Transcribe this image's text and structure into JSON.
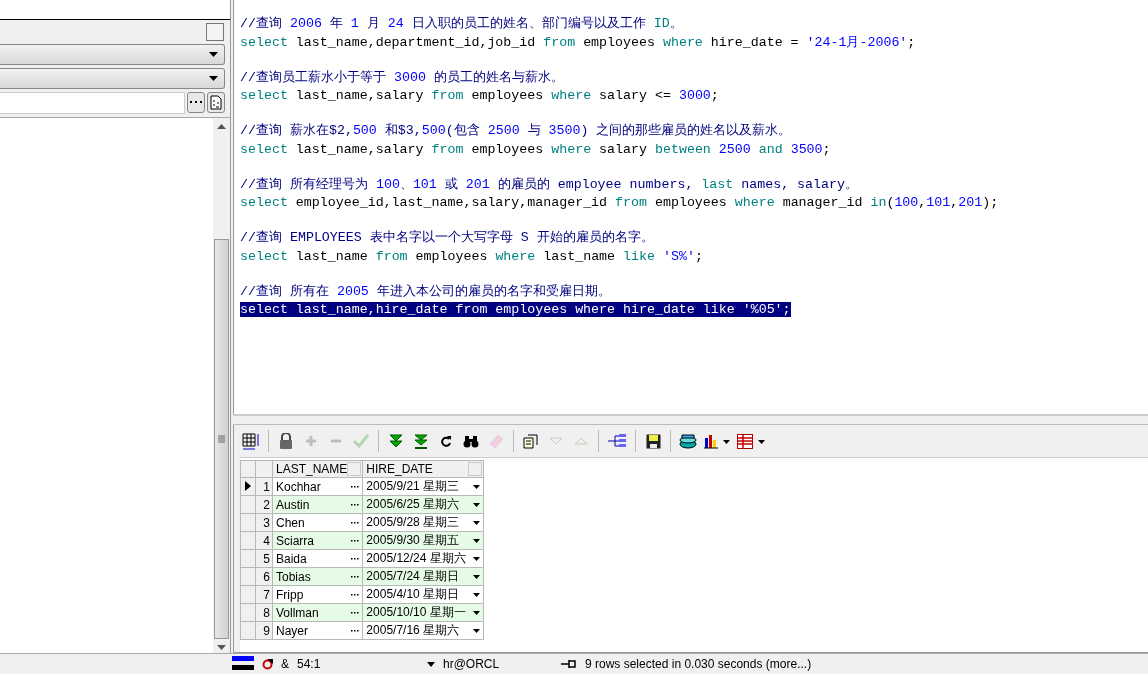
{
  "left_panel": {
    "checkbox": {
      "checked": false
    }
  },
  "editor": {
    "blocks": [
      {
        "lines": [
          {
            "selected": false,
            "tokens": [
              {
                "t": "//查询 ",
                "kind": "comment"
              },
              {
                "t": "2006",
                "kind": "number"
              },
              {
                "t": " 年 ",
                "kind": "comment"
              },
              {
                "t": "1",
                "kind": "number"
              },
              {
                "t": " 月 ",
                "kind": "comment"
              },
              {
                "t": "24",
                "kind": "number"
              },
              {
                "t": " 日入职的员工的姓名、部门编号以及工作 ",
                "kind": "comment"
              },
              {
                "t": "ID",
                "kind": "keyword"
              },
              {
                "t": "。",
                "kind": "comment"
              }
            ]
          },
          {
            "selected": false,
            "tokens": [
              {
                "t": "select",
                "kind": "keyword"
              },
              {
                "t": " last_name,department_id,job_id ",
                "kind": "plain"
              },
              {
                "t": "from",
                "kind": "keyword"
              },
              {
                "t": " employees ",
                "kind": "plain"
              },
              {
                "t": "where",
                "kind": "keyword"
              },
              {
                "t": " hire_date = ",
                "kind": "plain"
              },
              {
                "t": "'24-1月-2006'",
                "kind": "string"
              },
              {
                "t": ";",
                "kind": "plain"
              }
            ]
          }
        ]
      },
      {
        "lines": [
          {
            "selected": false,
            "tokens": [
              {
                "t": "//查询员工薪水小于等于 ",
                "kind": "comment"
              },
              {
                "t": "3000",
                "kind": "number"
              },
              {
                "t": " 的员工的姓名与薪水。",
                "kind": "comment"
              }
            ]
          },
          {
            "selected": false,
            "tokens": [
              {
                "t": "select",
                "kind": "keyword"
              },
              {
                "t": " last_name,salary ",
                "kind": "plain"
              },
              {
                "t": "from",
                "kind": "keyword"
              },
              {
                "t": " employees ",
                "kind": "plain"
              },
              {
                "t": "where",
                "kind": "keyword"
              },
              {
                "t": " salary <= ",
                "kind": "plain"
              },
              {
                "t": "3000",
                "kind": "number"
              },
              {
                "t": ";",
                "kind": "plain"
              }
            ]
          }
        ]
      },
      {
        "lines": [
          {
            "selected": false,
            "tokens": [
              {
                "t": "//查询 薪水在$2,",
                "kind": "comment"
              },
              {
                "t": "500",
                "kind": "number"
              },
              {
                "t": " 和$3,",
                "kind": "comment"
              },
              {
                "t": "500",
                "kind": "number"
              },
              {
                "t": "(包含 ",
                "kind": "comment"
              },
              {
                "t": "2500",
                "kind": "number"
              },
              {
                "t": " 与 ",
                "kind": "comment"
              },
              {
                "t": "3500",
                "kind": "number"
              },
              {
                "t": ") 之间的那些雇员的姓名以及薪水。",
                "kind": "comment"
              }
            ]
          },
          {
            "selected": false,
            "tokens": [
              {
                "t": "select",
                "kind": "keyword"
              },
              {
                "t": " last_name,salary ",
                "kind": "plain"
              },
              {
                "t": "from",
                "kind": "keyword"
              },
              {
                "t": " employees ",
                "kind": "plain"
              },
              {
                "t": "where",
                "kind": "keyword"
              },
              {
                "t": " salary ",
                "kind": "plain"
              },
              {
                "t": "between ",
                "kind": "keyword"
              },
              {
                "t": "2500 ",
                "kind": "number"
              },
              {
                "t": "and ",
                "kind": "keyword"
              },
              {
                "t": "3500",
                "kind": "number"
              },
              {
                "t": ";",
                "kind": "plain"
              }
            ]
          }
        ]
      },
      {
        "lines": [
          {
            "selected": false,
            "tokens": [
              {
                "t": "//查询 所有经理号为 ",
                "kind": "comment"
              },
              {
                "t": "100",
                "kind": "number"
              },
              {
                "t": "、",
                "kind": "comment"
              },
              {
                "t": "101",
                "kind": "number"
              },
              {
                "t": " 或 ",
                "kind": "comment"
              },
              {
                "t": "201",
                "kind": "number"
              },
              {
                "t": " 的雇员的 employee numbers, ",
                "kind": "comment"
              },
              {
                "t": "last",
                "kind": "keyword"
              },
              {
                "t": " names, salary。",
                "kind": "comment"
              }
            ]
          },
          {
            "selected": false,
            "tokens": [
              {
                "t": "select",
                "kind": "keyword"
              },
              {
                "t": " employee_id,last_name,salary,manager_id ",
                "kind": "plain"
              },
              {
                "t": "from",
                "kind": "keyword"
              },
              {
                "t": " employees ",
                "kind": "plain"
              },
              {
                "t": "where",
                "kind": "keyword"
              },
              {
                "t": " manager_id ",
                "kind": "plain"
              },
              {
                "t": "in",
                "kind": "keyword"
              },
              {
                "t": "(",
                "kind": "plain"
              },
              {
                "t": "100",
                "kind": "number"
              },
              {
                "t": ",",
                "kind": "plain"
              },
              {
                "t": "101",
                "kind": "number"
              },
              {
                "t": ",",
                "kind": "plain"
              },
              {
                "t": "201",
                "kind": "number"
              },
              {
                "t": ");",
                "kind": "plain"
              }
            ]
          }
        ]
      },
      {
        "lines": [
          {
            "selected": false,
            "tokens": [
              {
                "t": "//查询 EMPLOYEES 表中名字以一个大写字母 S 开始的雇员的名字。",
                "kind": "comment"
              }
            ]
          },
          {
            "selected": false,
            "tokens": [
              {
                "t": "select",
                "kind": "keyword"
              },
              {
                "t": " last_name ",
                "kind": "plain"
              },
              {
                "t": "from",
                "kind": "keyword"
              },
              {
                "t": " employees ",
                "kind": "plain"
              },
              {
                "t": "where",
                "kind": "keyword"
              },
              {
                "t": " last_name ",
                "kind": "plain"
              },
              {
                "t": "like ",
                "kind": "keyword"
              },
              {
                "t": "'S%'",
                "kind": "string"
              },
              {
                "t": ";",
                "kind": "plain"
              }
            ]
          }
        ]
      },
      {
        "lines": [
          {
            "selected": false,
            "tokens": [
              {
                "t": "//查询 所有在 ",
                "kind": "comment"
              },
              {
                "t": "2005",
                "kind": "number"
              },
              {
                "t": " 年进入本公司的雇员的名字和受雇日期。",
                "kind": "comment"
              }
            ]
          },
          {
            "selected": true,
            "text": "select last_name,hire_date from employees where hire_date like '%05';"
          }
        ]
      }
    ]
  },
  "toolbar": [
    {
      "kind": "grid",
      "disabled": false
    },
    {
      "kind": "sep"
    },
    {
      "kind": "lock",
      "disabled": false
    },
    {
      "kind": "plus",
      "disabled": true
    },
    {
      "kind": "minus",
      "disabled": true
    },
    {
      "kind": "check",
      "disabled": true
    },
    {
      "kind": "sep"
    },
    {
      "kind": "fetch",
      "disabled": false
    },
    {
      "kind": "fetchall",
      "disabled": false
    },
    {
      "kind": "refresh",
      "disabled": false
    },
    {
      "kind": "find",
      "disabled": false
    },
    {
      "kind": "eraser",
      "disabled": true
    },
    {
      "kind": "sep"
    },
    {
      "kind": "query",
      "disabled": false
    },
    {
      "kind": "down",
      "disabled": true
    },
    {
      "kind": "up",
      "disabled": true
    },
    {
      "kind": "sep"
    },
    {
      "kind": "tree",
      "disabled": false
    },
    {
      "kind": "sep"
    },
    {
      "kind": "save",
      "disabled": false
    },
    {
      "kind": "sep"
    },
    {
      "kind": "db",
      "disabled": false
    },
    {
      "kind": "chart",
      "disabled": false
    },
    {
      "kind": "table",
      "disabled": false
    }
  ],
  "grid": {
    "columns": [
      "LAST_NAME",
      "HIRE_DATE"
    ],
    "rows": [
      {
        "num": "1",
        "last_name": "Kochhar",
        "hire_date": "2005/9/21 星期三",
        "selected": true
      },
      {
        "num": "2",
        "last_name": "Austin",
        "hire_date": "2005/6/25 星期六",
        "selected": false
      },
      {
        "num": "3",
        "last_name": "Chen",
        "hire_date": "2005/9/28 星期三",
        "selected": false
      },
      {
        "num": "4",
        "last_name": "Sciarra",
        "hire_date": "2005/9/30 星期五",
        "selected": false
      },
      {
        "num": "5",
        "last_name": "Baida",
        "hire_date": "2005/12/24 星期六",
        "selected": false
      },
      {
        "num": "6",
        "last_name": "Tobias",
        "hire_date": "2005/7/24 星期日",
        "selected": false
      },
      {
        "num": "7",
        "last_name": "Fripp",
        "hire_date": "2005/4/10 星期日",
        "selected": false
      },
      {
        "num": "8",
        "last_name": "Vollman",
        "hire_date": "2005/10/10 星期一",
        "selected": false
      },
      {
        "num": "9",
        "last_name": "Nayer",
        "hire_date": "2005/7/16 星期六",
        "selected": false
      }
    ]
  },
  "status_bar": {
    "ampersand": "&",
    "position": "54:1",
    "connection": "hr@ORCL",
    "message": "9 rows selected in 0.030 seconds (more...)"
  }
}
